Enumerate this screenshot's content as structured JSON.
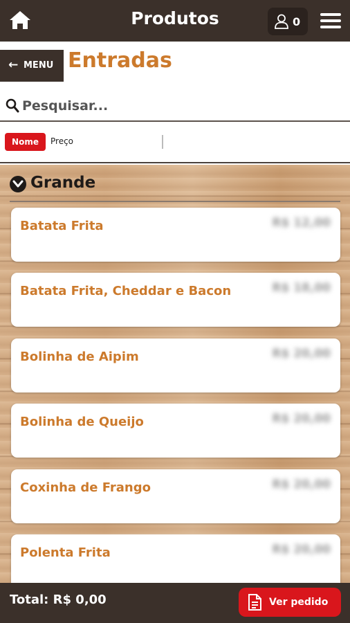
{
  "header": {
    "title": "Produtos",
    "cart_count": "0"
  },
  "nav": {
    "back_label": "MENU",
    "page_title": "Entradas"
  },
  "search": {
    "placeholder": "Pesquisar..."
  },
  "sort": {
    "options": [
      "Nome",
      "Preço"
    ],
    "active": "Nome"
  },
  "category": {
    "label": "Grande"
  },
  "items": [
    {
      "name": "Batata Frita",
      "price": "R$ 12,00"
    },
    {
      "name": "Batata Frita, Cheddar e Bacon",
      "price": "R$ 18,00"
    },
    {
      "name": "Bolinha de Aipim",
      "price": "R$ 20,00"
    },
    {
      "name": "Bolinha de Queijo",
      "price": "R$ 20,00"
    },
    {
      "name": "Coxinha de Frango",
      "price": "R$ 20,00"
    },
    {
      "name": "Polenta Frita",
      "price": "R$ 20,00"
    }
  ],
  "footer": {
    "total": "Total: R$ 0,00",
    "order_label": "Ver pedido"
  },
  "colors": {
    "bar": "#3b302a",
    "accent": "#cc7a2c",
    "button_red": "#d9161c"
  }
}
